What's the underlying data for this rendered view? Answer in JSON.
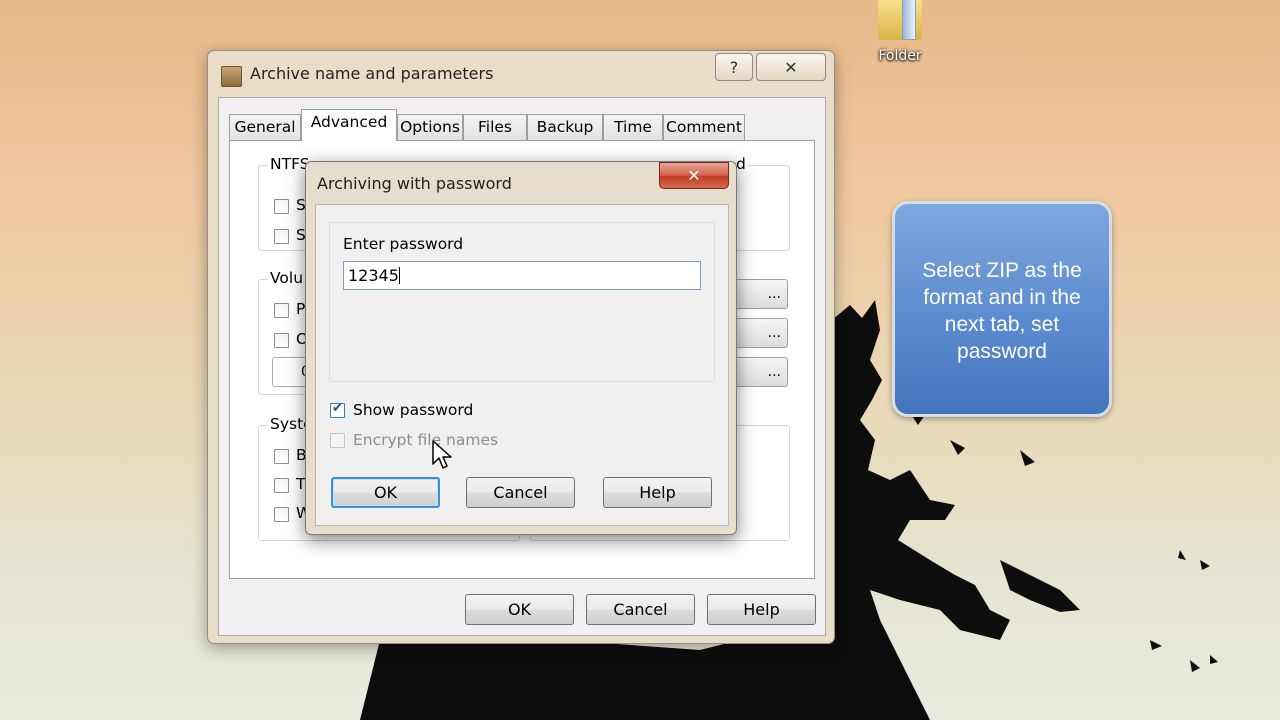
{
  "desktop": {
    "folder_icon": {
      "label": "Folder",
      "icon": "folder-icon"
    }
  },
  "callout": {
    "text": "Select ZIP as the format and in the next tab, set password"
  },
  "main_window": {
    "title": "Archive name and parameters",
    "help_glyph": "?",
    "close_glyph": "✕",
    "tabs": [
      {
        "label": "General",
        "active": false
      },
      {
        "label": "Advanced",
        "active": true
      },
      {
        "label": "Options",
        "active": false
      },
      {
        "label": "Files",
        "active": false
      },
      {
        "label": "Backup",
        "active": false
      },
      {
        "label": "Time",
        "active": false
      },
      {
        "label": "Comment",
        "active": false
      }
    ],
    "panel": {
      "ntfs_group_title": "NTFS",
      "ntfs_options": [
        "S",
        "S"
      ],
      "right_group_title": "d",
      "volume_group_title": "Volu",
      "volume_options": [
        "P",
        "O"
      ],
      "volume_field_text": "0",
      "side_buttons": [
        "...",
        "...",
        "..."
      ],
      "system_group_title": "Syste",
      "system_options": [
        "B",
        "T",
        "W"
      ]
    },
    "buttons": {
      "ok": "OK",
      "cancel": "Cancel",
      "help": "Help"
    }
  },
  "password_dialog": {
    "title": "Archiving with password",
    "close_glyph": "✕",
    "enter_password_label": "Enter password",
    "password_value": "12345",
    "show_password": {
      "label": "Show password",
      "checked": true
    },
    "encrypt_file_names": {
      "label": "Encrypt file names",
      "checked": false,
      "enabled": false
    },
    "buttons": {
      "ok": "OK",
      "cancel": "Cancel",
      "help": "Help"
    }
  },
  "colors": {
    "callout_blue": "#5b8bcf",
    "close_red": "#c13d22",
    "default_button_border": "#3c8ed6"
  }
}
